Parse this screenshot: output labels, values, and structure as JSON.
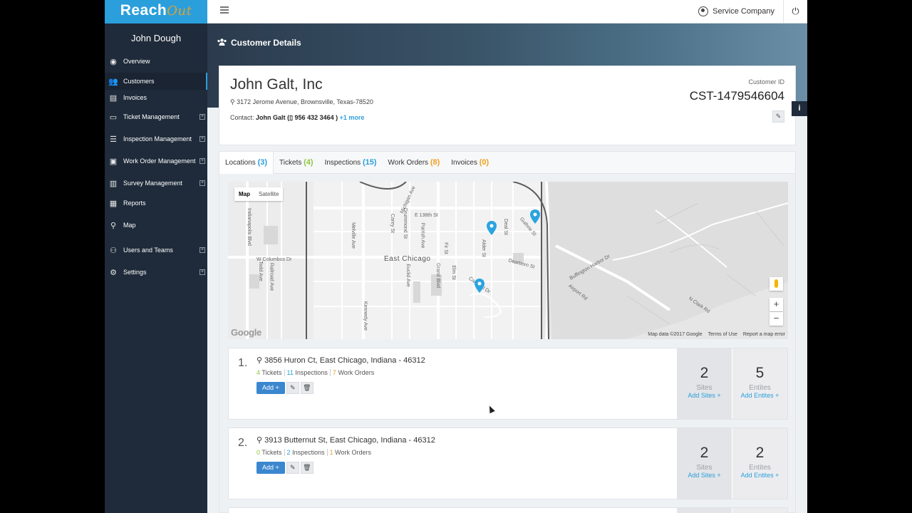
{
  "app": {
    "logo_main": "Reach",
    "logo_script": "Out"
  },
  "topbar": {
    "company": "Service Company"
  },
  "sidebar": {
    "user_name": "John Dough",
    "items": [
      {
        "label": "Overview",
        "icon": "dashboard-icon",
        "expandable": false,
        "active": false
      },
      {
        "label": "Customers",
        "icon": "users-icon",
        "expandable": false,
        "active": true
      },
      {
        "label": "Invoices",
        "icon": "money-icon",
        "expandable": false,
        "active": false
      },
      {
        "label": "Ticket Management",
        "icon": "ticket-icon",
        "expandable": true,
        "active": false
      },
      {
        "label": "Inspection Management",
        "icon": "clipboard-icon",
        "expandable": true,
        "active": false
      },
      {
        "label": "Work Order Management",
        "icon": "briefcase-icon",
        "expandable": true,
        "active": false
      },
      {
        "label": "Survey Management",
        "icon": "survey-icon",
        "expandable": true,
        "active": false
      },
      {
        "label": "Reports",
        "icon": "report-icon",
        "expandable": false,
        "active": false
      },
      {
        "label": "Map",
        "icon": "map-pin-icon",
        "expandable": false,
        "active": false
      },
      {
        "label": "Users and Teams",
        "icon": "user-icon",
        "expandable": true,
        "active": false
      },
      {
        "label": "Settings",
        "icon": "gear-icon",
        "expandable": true,
        "active": false
      }
    ]
  },
  "page": {
    "title": "Customer Details"
  },
  "customer": {
    "name": "John Galt, Inc",
    "address": "3172 Jerome Avenue, Brownsville, Texas-78520",
    "contact_label": "Contact:",
    "contact_name": "John Galt",
    "contact_phone": "956 432 3464",
    "contact_more": "+1 more",
    "id_label": "Customer ID",
    "id": "CST-1479546604"
  },
  "tabs": [
    {
      "label": "Locations",
      "count": "(3)",
      "color": "blue",
      "active": true
    },
    {
      "label": "Tickets",
      "count": "(4)",
      "color": "green",
      "active": false
    },
    {
      "label": "Inspections",
      "count": "(15)",
      "color": "blue",
      "active": false
    },
    {
      "label": "Work Orders",
      "count": "(8)",
      "color": "orange",
      "active": false
    },
    {
      "label": "Invoices",
      "count": "(0)",
      "color": "orange",
      "active": false
    }
  ],
  "map": {
    "type_map": "Map",
    "type_satellite": "Satellite",
    "city_label": "East Chicago",
    "footer_data": "Map data ©2017 Google",
    "footer_terms": "Terms of Use",
    "footer_report": "Report a map error",
    "google": "Google",
    "street_labels": [
      "Indianapolis Blvd",
      "W Columbus Dr",
      "Michigan Ave",
      "E 138th St",
      "Guthrie St",
      "Airport Rd",
      "Buffington Harbor Dr",
      "Kennedy Ave",
      "Cardinal Dr",
      "Euclid Ave",
      "Railroad Ave",
      "Melville Ave",
      "Carey St",
      "Drummond St",
      "Parrish Ave",
      "Alder St",
      "Deal St",
      "Dearborn St",
      "Grand Blvd",
      "N Clark Rd",
      "Todd Ave",
      "Fir St",
      "Elm St"
    ]
  },
  "locations": [
    {
      "num": "1.",
      "address": "3856 Huron Ct, East Chicago, Indiana - 46312",
      "tickets_n": "4",
      "tickets_l": "Tickets",
      "insp_n": "11",
      "insp_l": "Inspections",
      "wo_n": "7",
      "wo_l": "Work Orders",
      "add_label": "Add +",
      "sites": "2",
      "sites_label": "Sites",
      "sites_add": "Add Sites +",
      "entities": "5",
      "entities_label": "Entites",
      "entities_add": "Add Entites +"
    },
    {
      "num": "2.",
      "address": "3913 Butternut St, East Chicago, Indiana - 46312",
      "tickets_n": "0",
      "tickets_l": "Tickets",
      "insp_n": "2",
      "insp_l": "Inspections",
      "wo_n": "1",
      "wo_l": "Work Orders",
      "add_label": "Add +",
      "sites": "2",
      "sites_label": "Sites",
      "sites_add": "Add Sites +",
      "entities": "2",
      "entities_label": "Entites",
      "entities_add": "Add Entites +"
    }
  ]
}
